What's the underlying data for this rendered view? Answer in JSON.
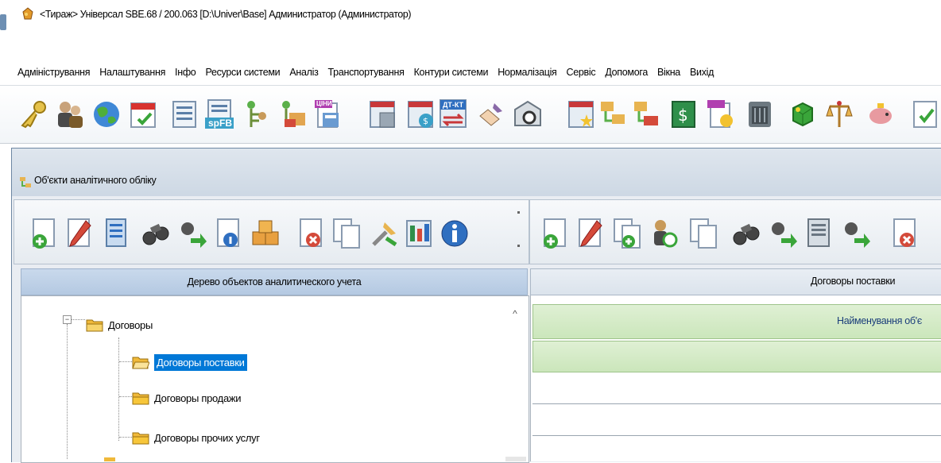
{
  "window": {
    "title": "<Тираж>  Універсал SBE.68 / 200.063   [D:\\Univer\\Base]   Администратор (Администратор)"
  },
  "menu": [
    "Адміністрування",
    "Налаштування",
    "Інфо",
    "Ресурси системи",
    "Аналіз",
    "Транспортування",
    "Контури системи",
    "Нормалізація",
    "Сервіс",
    "Допомога",
    "Вікна",
    "Вихід"
  ],
  "main_toolbar": {
    "icons": [
      "key-icon",
      "users-icon",
      "globe-icon",
      "calendar-icon",
      "form-icon",
      "spfb-form-icon",
      "person-green-icon",
      "person-folder-icon",
      "price-doc-icon",
      "calculator-doc-icon",
      "calculator-dollar-icon",
      "debit-credit-icon",
      "pen-hand-icon",
      "camera-safe-icon",
      "calculator-star-icon",
      "tree-folder-icon",
      "folder-move-icon",
      "dollar-icon",
      "price-list-icon",
      "archive-box-icon",
      "green-cube-icon",
      "scales-icon",
      "piggy-bank-icon",
      "document-check-icon"
    ],
    "spfb_label": "spFB",
    "price_label": "ЦІНИ",
    "dtkt_label": "ДТ-КТ"
  },
  "inner_window": {
    "title": "Об'єкти аналітичного обліку"
  },
  "left_toolbar": {
    "icons": [
      "add-document-icon",
      "edit-icon",
      "list-view-icon",
      "binoculars-icon",
      "find-next-icon",
      "document-info-icon",
      "boxes-icon",
      "delete-document-icon",
      "copy-icon",
      "tools-icon",
      "report-icon",
      "info-icon"
    ]
  },
  "right_toolbar": {
    "icons": [
      "add-document-icon",
      "edit-icon",
      "add-copy-icon",
      "user-refresh-icon",
      "copy-icon",
      "binoculars-icon",
      "find-next-icon",
      "filter-doc-icon",
      "find-next-icon",
      "delete-document-icon"
    ]
  },
  "left_panel": {
    "header": "Дерево объектов аналитического учета",
    "tree": [
      {
        "label": "Договоры",
        "level": 0,
        "selected": false
      },
      {
        "label": "Договоры поставки",
        "level": 1,
        "selected": true
      },
      {
        "label": "Договоры продажи",
        "level": 1,
        "selected": false
      },
      {
        "label": "Договоры прочих услуг",
        "level": 1,
        "selected": false
      }
    ],
    "expander": "−",
    "scroll_up": "^"
  },
  "right_panel": {
    "header": "Договоры поставки",
    "column_header": "Найменування об'є"
  },
  "colors": {
    "selection": "#0078d7",
    "left_header": "#bcd0e8",
    "grid_header": "#d4ebc5",
    "column_text": "#1a3d7a"
  }
}
